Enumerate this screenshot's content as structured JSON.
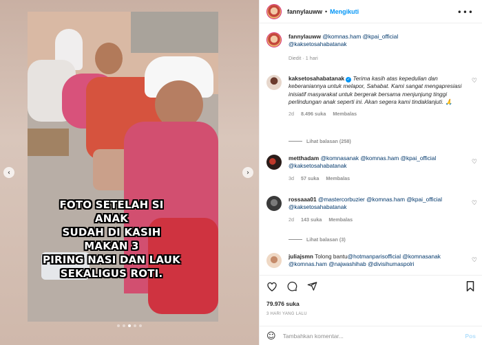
{
  "header": {
    "username": "fannylauww",
    "separator": "•",
    "follow_label": "Mengikuti",
    "more_icon": "more-horizontal-icon"
  },
  "caption": {
    "username": "fannylauww",
    "mentions": [
      "@komnas.ham",
      "@kpai_official",
      "@kaksetosahabatanak"
    ],
    "edited": "Diedit",
    "sep": "·",
    "time": "1 hari"
  },
  "comments": [
    {
      "username": "kaksetosahabatanak",
      "verified": true,
      "text": "Terima kasih atas kepedulian dan keberaniannya untuk melapor, Sahabat. Kami sangat mengapresiasi inisiatif masyarakat untuk bergerak bersama menjunjung tinggi perlindungan anak seperti ini. Akan segera kami tindaklanjuti. 🙏",
      "time": "2d",
      "likes": "8.496 suka",
      "reply_label": "Membalas",
      "replies": "Lihat balasan (258)"
    },
    {
      "username": "metthadam",
      "mentions": "@komnasanak @komnas.ham @kpai_official @kaksetosahabatanak",
      "time": "3d",
      "likes": "57 suka",
      "reply_label": "Membalas"
    },
    {
      "username": "rossaaa01",
      "mentions": "@mastercorbuzier @komnas.ham @kpai_official @kaksetosahabatanak",
      "time": "2d",
      "likes": "143 suka",
      "reply_label": "Membalas",
      "replies": "Lihat balasan (3)"
    },
    {
      "username": "juliajsmn",
      "text_prefix": "Tolong bantu",
      "mentions": "@hotmanparisofficial @komnasanak @komnas.ham @najwashihab @divisihumaspolri"
    }
  ],
  "actions": {
    "like_icon": "heart-icon",
    "comment_icon": "comment-icon",
    "share_icon": "share-icon",
    "save_icon": "bookmark-icon",
    "likes_count": "79.976 suka",
    "timestamp": "3 HARI YANG LALU"
  },
  "add_comment": {
    "placeholder": "Tambahkan komentar...",
    "post_label": "Pos",
    "emoji_icon": "smiley-icon"
  },
  "media": {
    "overlay_text": "FOTO SETELAH SI ANAK\nSUDAH DI KASIH MAKAN 3\nPIRING NASI DAN LAUK\nSEKALIGUS ROTI.",
    "prev_icon": "chevron-left-icon",
    "next_icon": "chevron-right-icon",
    "carousel": {
      "total": 5,
      "active_index": 2
    }
  },
  "colors": {
    "link": "#00376b",
    "accent": "#0095f6",
    "muted": "#8e8e8e",
    "text": "#262626"
  }
}
